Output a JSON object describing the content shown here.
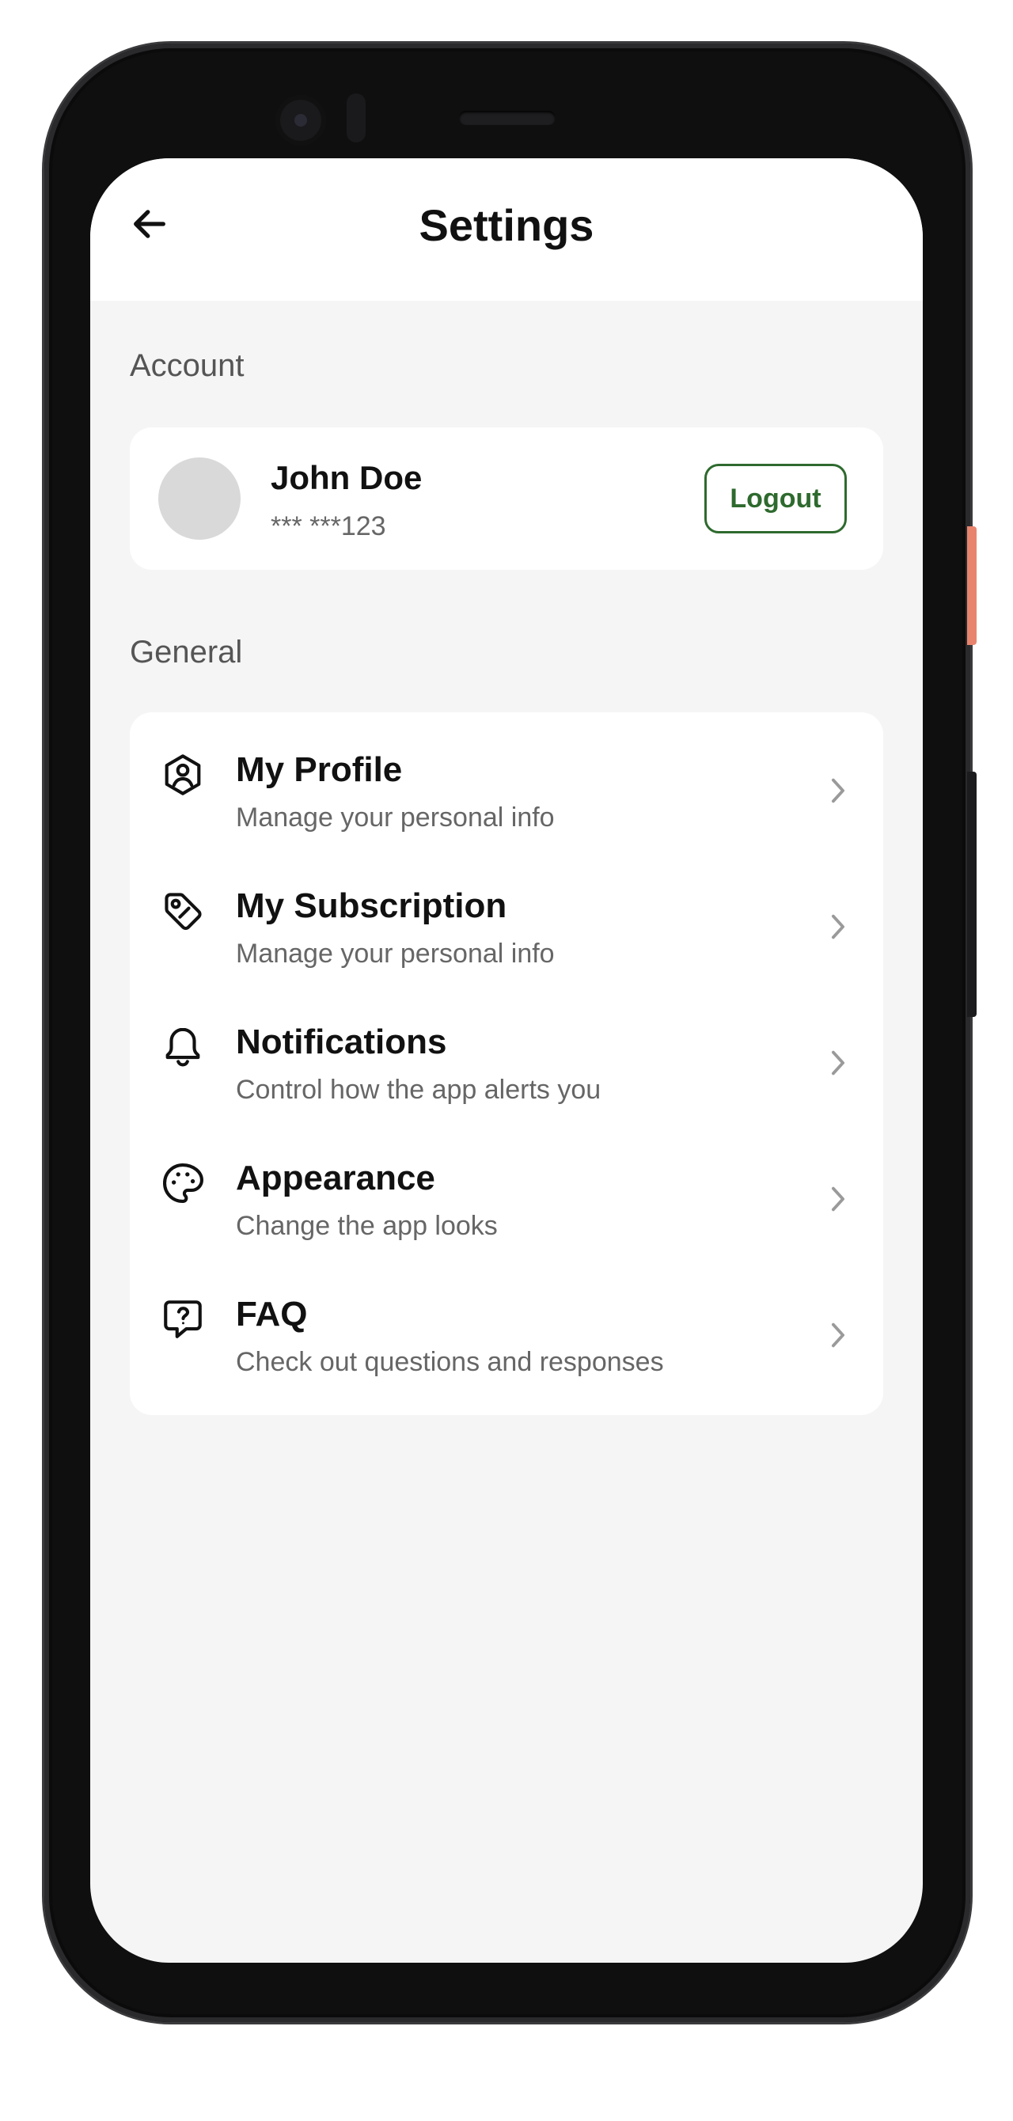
{
  "header": {
    "title": "Settings"
  },
  "account": {
    "section_label": "Account",
    "name": "John Doe",
    "phone_masked": "*** ***123",
    "logout_label": "Logout"
  },
  "general": {
    "section_label": "General",
    "items": [
      {
        "title": "My Profile",
        "subtitle": "Manage your personal info",
        "icon": "user-hexagon-icon"
      },
      {
        "title": "My Subscription",
        "subtitle": "Manage your personal info",
        "icon": "tag-icon"
      },
      {
        "title": "Notifications",
        "subtitle": "Control how the app alerts you",
        "icon": "bell-icon"
      },
      {
        "title": "Appearance",
        "subtitle": "Change the app looks",
        "icon": "palette-icon"
      },
      {
        "title": "FAQ",
        "subtitle": "Check out questions and responses",
        "icon": "help-bubble-icon"
      }
    ]
  },
  "colors": {
    "accent": "#2e6a2e",
    "background": "#f5f5f5",
    "card": "#ffffff",
    "side_button": "#e8846e"
  }
}
